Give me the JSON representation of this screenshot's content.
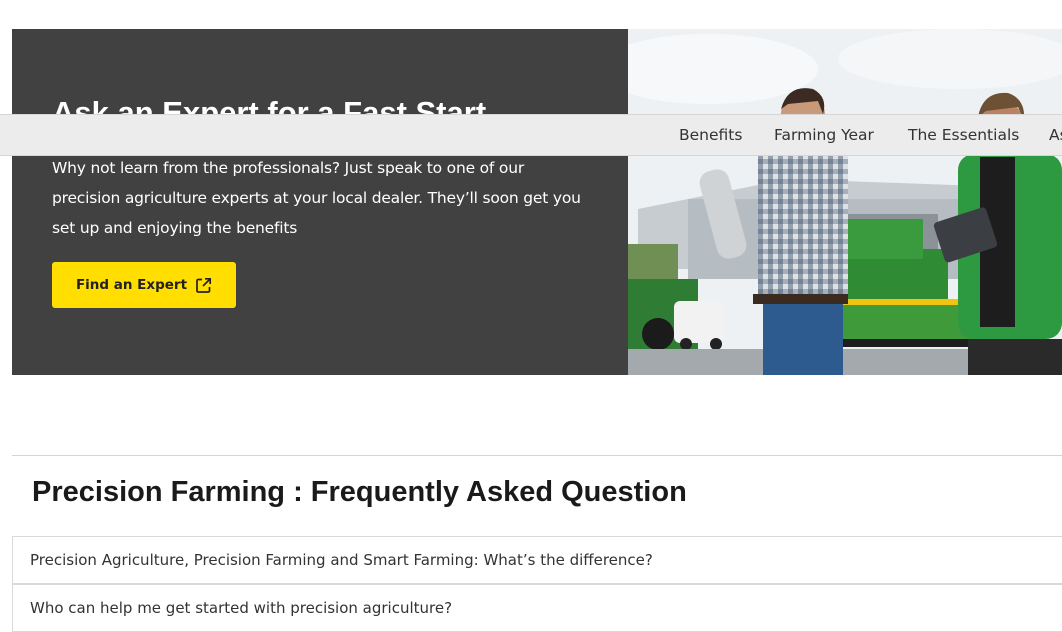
{
  "hero": {
    "title": "Ask an Expert for a Fast Start",
    "body": "Why not learn from the professionals? Just speak to one of our precision agriculture experts at your local dealer. They’ll soon get you set up and enjoying the benefits",
    "button_label": "Find an Expert",
    "button_icon": "external-link-icon",
    "image_alt": "Two men talking in front of green farm machinery"
  },
  "subnav": {
    "items": [
      {
        "label": "Benefits"
      },
      {
        "label": "Farming Year"
      },
      {
        "label": "The Essentials"
      },
      {
        "label": "As"
      }
    ]
  },
  "faq": {
    "title": "Precision Farming : Frequently Asked Question",
    "items": [
      {
        "question": "Precision Agriculture, Precision Farming and Smart Farming: What’s the difference?"
      },
      {
        "question": "Who can help me get started with precision agriculture?"
      }
    ]
  },
  "colors": {
    "hero_bg": "#414141",
    "button_bg": "#ffde00",
    "subnav_bg": "#ececec",
    "machine_green": "#3f9b3a"
  }
}
